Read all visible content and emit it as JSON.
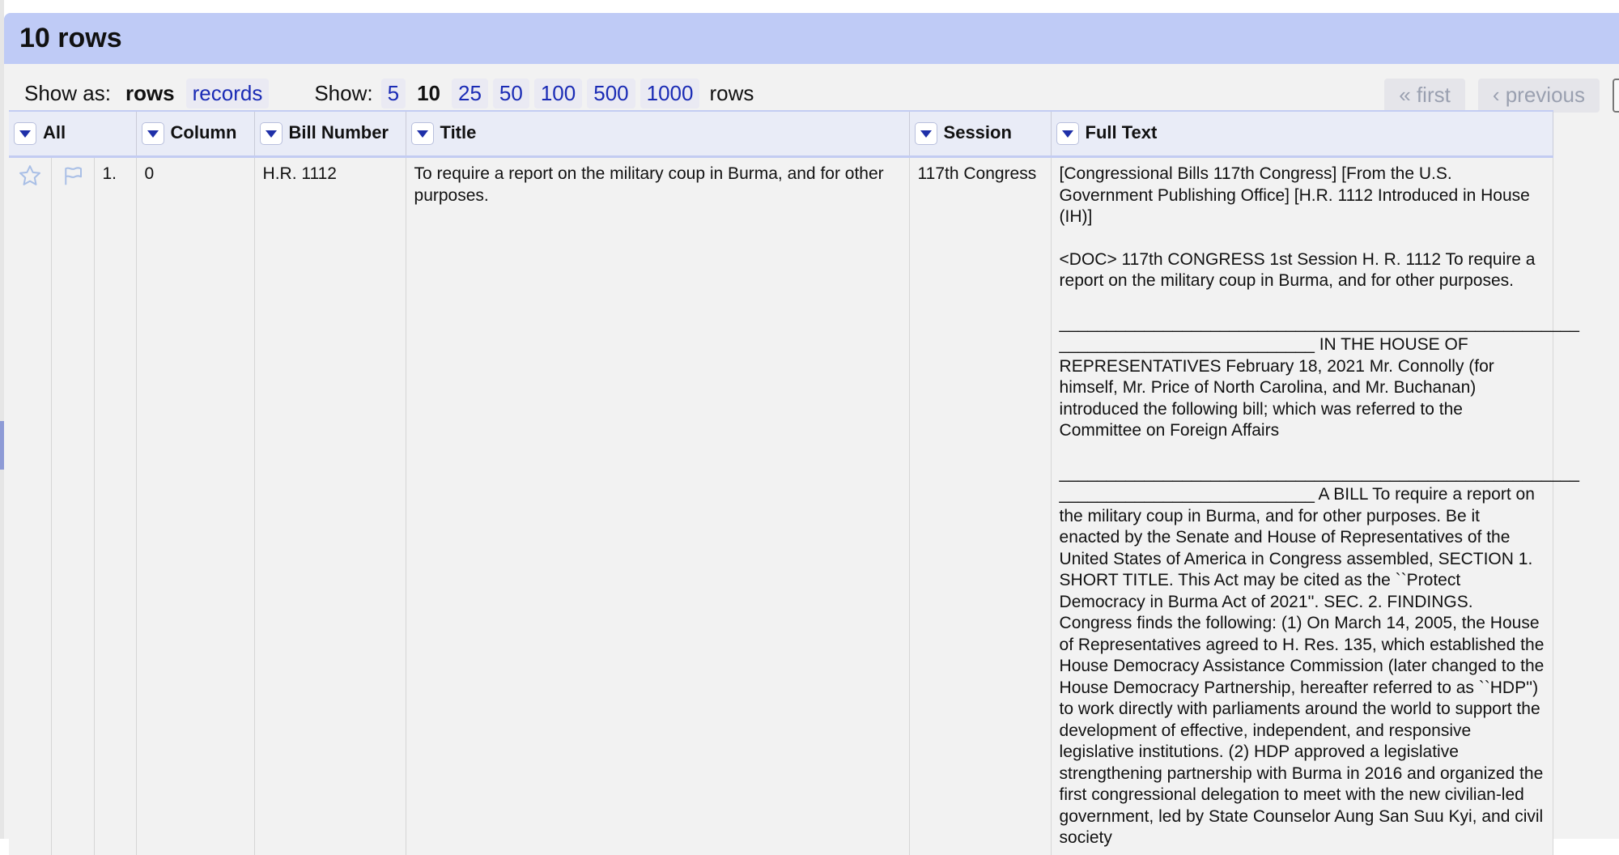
{
  "header": {
    "row_count": "10 rows"
  },
  "toolbar": {
    "show_as_label": "Show as:",
    "view_rows": "rows",
    "view_records": "records",
    "show_label": "Show:",
    "page_sizes": [
      "5",
      "10",
      "25",
      "50",
      "100",
      "500",
      "1000"
    ],
    "selected_page_size": "10",
    "rows_suffix": "rows",
    "first": "« first",
    "previous": "‹ previous"
  },
  "columns": [
    {
      "label": "All"
    },
    {
      "label": "Column"
    },
    {
      "label": "Bill Number"
    },
    {
      "label": "Title"
    },
    {
      "label": "Session"
    },
    {
      "label": "Full Text"
    }
  ],
  "rows": [
    {
      "index": "1.",
      "column": "0",
      "bill_number": "H.R. 1112",
      "title": "To require a report on the military coup in Burma, and for other purposes.",
      "session": "117th Congress",
      "full_text": [
        "[Congressional Bills 117th Congress] [From the U.S. Government Publishing Office] [H.R. 1112 Introduced in House (IH)]",
        "<DOC> 117th CONGRESS 1st Session H. R. 1112 To require a report on the military coup in Burma, and for other purposes.",
        "_______________________________________________________ ___________________________ IN THE HOUSE OF REPRESENTATIVES February 18, 2021 Mr. Connolly (for himself, Mr. Price of North Carolina, and Mr. Buchanan) introduced the following bill; which was referred to the Committee on Foreign Affairs",
        "_______________________________________________________ ___________________________ A BILL To require a report on the military coup in Burma, and for other purposes. Be it enacted by the Senate and House of Representatives of the United States of America in Congress assembled, SECTION 1. SHORT TITLE. This Act may be cited as the ``Protect Democracy in Burma Act of 2021''. SEC. 2. FINDINGS. Congress finds the following: (1) On March 14, 2005, the House of Representatives agreed to H. Res. 135, which established the House Democracy Assistance Commission (later changed to the House Democracy Partnership, hereafter referred to as ``HDP'') to work directly with parliaments around the world to support the development of effective, independent, and responsive legislative institutions. (2) HDP approved a legislative strengthening partnership with Burma in 2016 and organized the first congressional delegation to meet with the new civilian-led government, led by State Counselor Aung San Suu Kyi, and civil society"
      ]
    }
  ]
}
